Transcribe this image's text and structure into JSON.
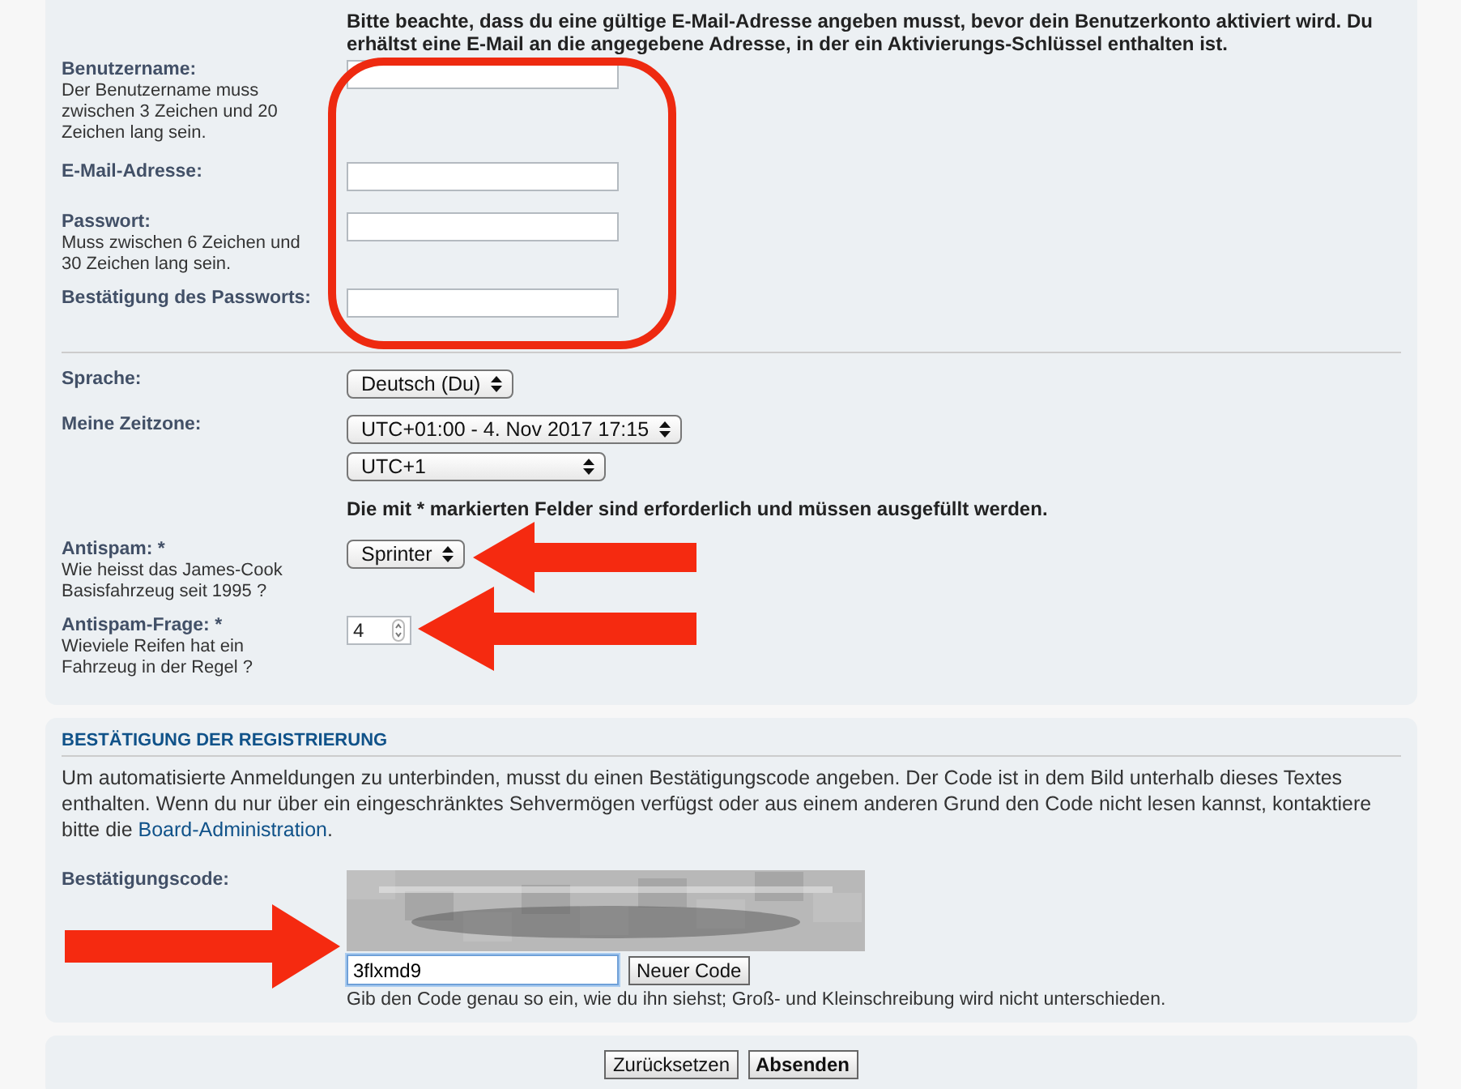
{
  "notice": "Bitte beachte, dass du eine gültige E-Mail-Adresse angeben musst, bevor dein Benutzerkonto aktiviert wird. Du erhältst eine E-Mail an die angegebene Adresse, in der ein Aktivierungs-Schlüssel enthalten ist.",
  "account_fields": [
    {
      "label": "Benutzername:",
      "hint": "Der Benutzername muss zwischen 3 Zeichen und 20 Zeichen lang sein."
    },
    {
      "label": "E-Mail-Adresse:"
    },
    {
      "label": "Passwort:",
      "hint": "Muss zwischen 6 Zeichen und 30 Zeichen lang sein."
    },
    {
      "label": "Bestätigung des Passworts:"
    }
  ],
  "settings": [
    {
      "label": "Sprache:",
      "dropdowns": [
        "Deutsch (Du)"
      ]
    },
    {
      "label": "Meine Zeitzone:",
      "dropdowns": [
        "UTC+01:00 - 4. Nov 2017 17:15",
        "UTC+1"
      ]
    }
  ],
  "required_note": "Die mit * markierten Felder sind erforderlich und müssen ausgefüllt werden.",
  "antispam": [
    {
      "kind": "dropdown",
      "label": "Antispam: *",
      "hint": "Wie heisst das James-Cook Basisfahrzeug seit 1995 ?",
      "value": "Sprinter"
    },
    {
      "kind": "number",
      "label": "Antispam-Frage: *",
      "hint": "Wieviele Reifen hat ein Fahrzeug in der Regel ?",
      "value": "4"
    }
  ],
  "confirmation": {
    "heading": "BESTÄTIGUNG DER REGISTRIERUNG",
    "text_before": "Um automatisierte Anmeldungen zu unterbinden, musst du einen Bestätigungscode angeben. Der Code ist in dem Bild unterhalb dieses Textes enthalten. Wenn du nur über ein eingeschränktes Sehvermögen verfügst oder aus einem anderen Grund den Code nicht lesen kannst, kontaktiere bitte die ",
    "link": "Board-Administration",
    "text_after": ".",
    "code_label": "Bestätigungscode:",
    "code_value": "3flxmd9",
    "new_code_button": "Neuer Code",
    "code_hint": "Gib den Code genau so ein, wie du ihn siehst; Groß- und Kleinschreibung wird nicht unterschieden."
  },
  "buttons": [
    {
      "label": "Zurücksetzen",
      "primary": false
    },
    {
      "label": "Absenden",
      "primary": true
    }
  ]
}
